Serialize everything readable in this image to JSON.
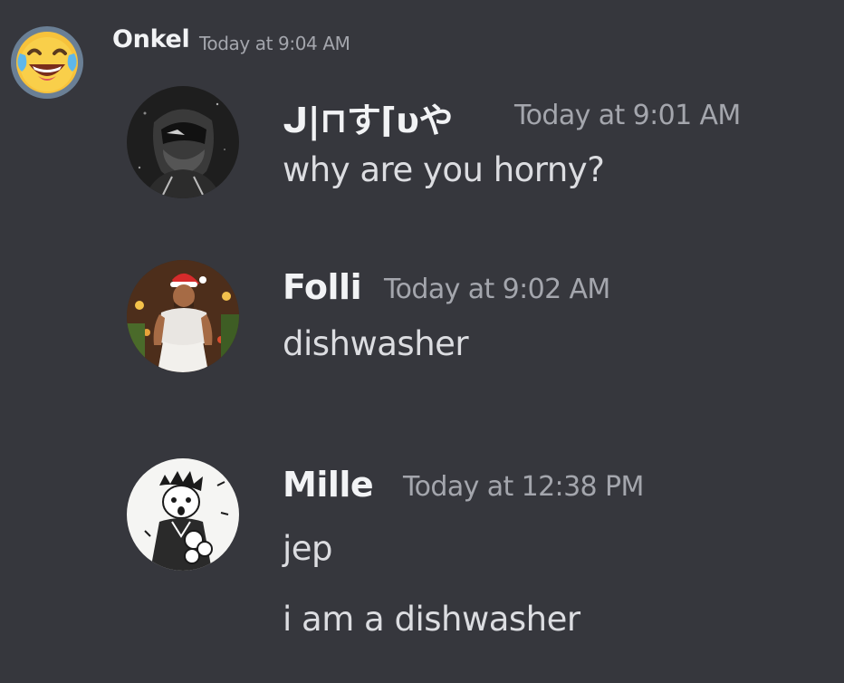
{
  "outer_message": {
    "username": "Onkel",
    "timestamp": "Today at 9:04 AM",
    "avatar_icon": "laughing-crying-emoji-icon"
  },
  "quoted_messages": [
    {
      "username": "ᒍ|⊓す⌈υや",
      "timestamp": "Today at 9:01 AM",
      "lines": [
        "why are you horny?"
      ],
      "avatar_icon": "helmeted-figure-avatar"
    },
    {
      "username": "Folli",
      "timestamp": "Today at 9:02 AM",
      "lines": [
        "dishwasher"
      ],
      "avatar_icon": "santa-hat-figure-avatar"
    },
    {
      "username": "Mille",
      "timestamp": "Today at 12:38 PM",
      "lines": [
        "jep",
        "i am a dishwasher"
      ],
      "avatar_icon": "manga-sketch-avatar"
    }
  ],
  "colors": {
    "background": "#36373d",
    "username": "#f2f3f5",
    "timestamp": "#a4a6ad",
    "message_text": "#dcdde1"
  }
}
